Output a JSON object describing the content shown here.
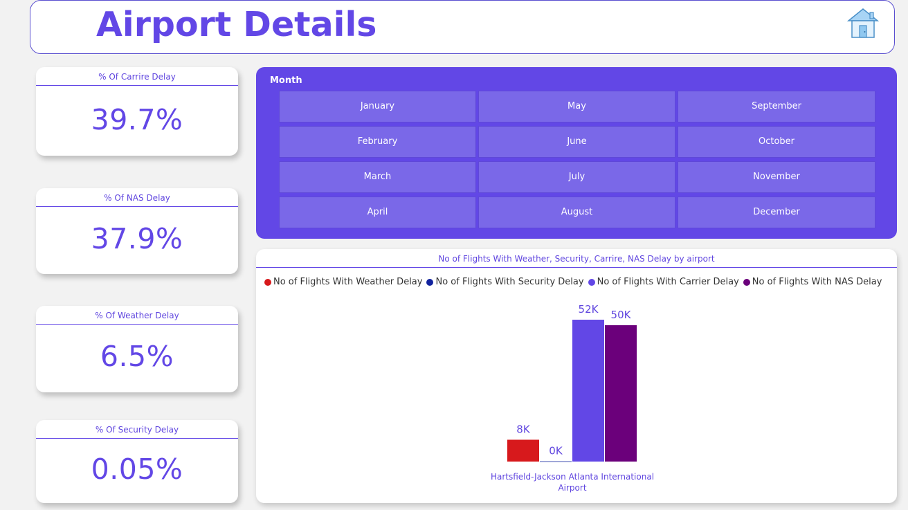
{
  "header": {
    "title": "Airport Details",
    "home_icon": "home-icon"
  },
  "kpis": [
    {
      "label": "% Of Carrire Delay",
      "value": "39.7%"
    },
    {
      "label": "% Of NAS Delay",
      "value": "37.9%"
    },
    {
      "label": "% Of Weather Delay",
      "value": "6.5%"
    },
    {
      "label": "% Of Security Delay",
      "value": "0.05%"
    }
  ],
  "month_slicer": {
    "label": "Month",
    "months": [
      "January",
      "May",
      "September",
      "February",
      "June",
      "October",
      "March",
      "July",
      "November",
      "April",
      "August",
      "December"
    ]
  },
  "colors": {
    "accent": "#6247e6",
    "weather": "#d7191c",
    "security": "#12239e",
    "carrier": "#6247e6",
    "nas": "#6b007b"
  },
  "chart_data": {
    "type": "bar",
    "title": "No of Flights With Weather, Security, Carrire, NAS Delay by airport",
    "categories": [
      "Hartsfield-Jackson Atlanta International Airport"
    ],
    "category_lines": [
      "Hartsfield-Jackson Atlanta International",
      "Airport"
    ],
    "series": [
      {
        "name": "No of Flights With Weather Delay",
        "values": [
          8000
        ],
        "label": "8K",
        "color": "#d7191c"
      },
      {
        "name": "No of Flights With Security Delay",
        "values": [
          100
        ],
        "label": "0K",
        "color": "#12239e"
      },
      {
        "name": "No of Flights With Carrier Delay",
        "values": [
          52000
        ],
        "label": "52K",
        "color": "#6247e6"
      },
      {
        "name": "No of Flights With NAS Delay",
        "values": [
          50000
        ],
        "label": "50K",
        "color": "#6b007b"
      }
    ],
    "ylim": [
      0,
      52000
    ],
    "legend_position": "top-left",
    "grid": false
  }
}
